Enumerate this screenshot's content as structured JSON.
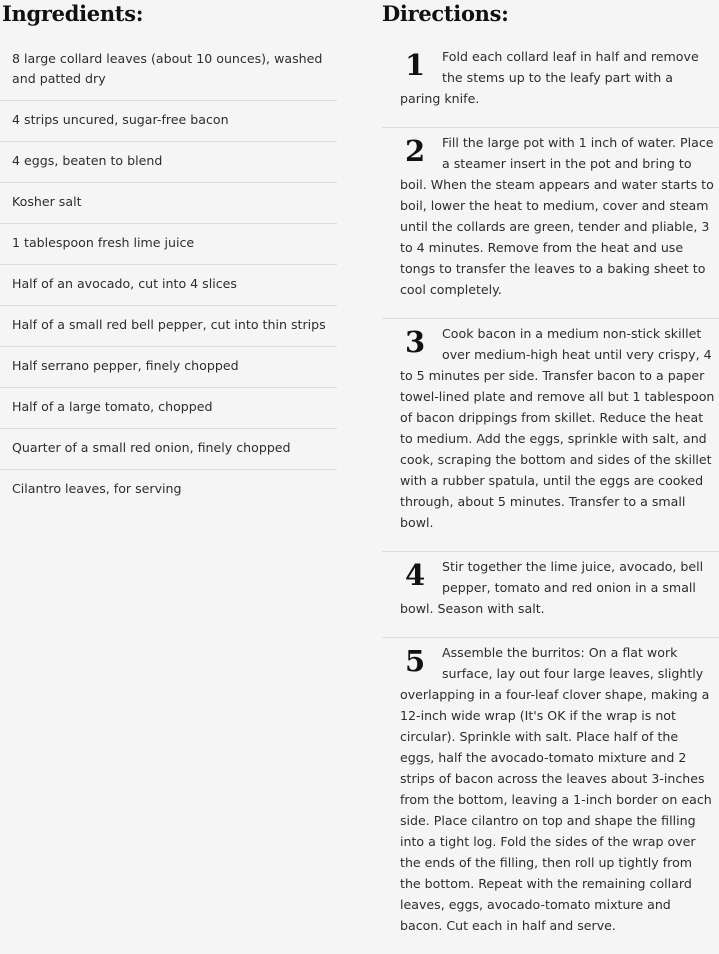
{
  "ingredients": {
    "heading": "Ingredients:",
    "items": [
      "8 large collard leaves (about 10 ounces), washed and patted dry",
      "4 strips uncured, sugar-free bacon",
      "4 eggs, beaten to blend",
      "Kosher salt",
      "1 tablespoon fresh lime juice",
      "Half of an avocado, cut into 4 slices",
      "Half of a small red bell pepper, cut into thin strips",
      "Half serrano pepper, finely chopped",
      "Half of a large tomato, chopped",
      "Quarter of a small red onion, finely chopped",
      "Cilantro leaves, for serving"
    ]
  },
  "directions": {
    "heading": "Directions:",
    "steps": [
      {
        "number": "1",
        "text": "Fold each collard leaf in half and remove the stems up to the leafy part with a paring knife."
      },
      {
        "number": "2",
        "text": "Fill the large pot with 1 inch of water. Place a steamer insert in the pot and bring to boil. When the steam appears and water starts to boil, lower the heat to medium, cover and steam until the collards are green, tender and pliable, 3 to 4 minutes. Remove from the heat and use tongs to transfer the leaves to a baking sheet to cool completely."
      },
      {
        "number": "3",
        "text": "Cook bacon in a medium non-stick skillet over medium-high heat until very crispy, 4 to 5 minutes per side. Transfer bacon to a paper towel-lined plate and remove all but 1 tablespoon of bacon drippings from skillet. Reduce the heat to medium. Add the eggs, sprinkle with salt, and cook, scraping the bottom and sides of the skillet with a rubber spatula, until the eggs are cooked through, about 5 minutes. Transfer to a small bowl."
      },
      {
        "number": "4",
        "text": "Stir together the lime juice, avocado, bell pepper, tomato and red onion in a small bowl. Season with salt."
      },
      {
        "number": "5",
        "text": "Assemble the burritos: On a flat work surface, lay out four large leaves, slightly overlapping in a four-leaf clover shape, making a 12-inch wide wrap (It's OK if the wrap is not circular). Sprinkle with salt. Place half of the eggs, half the avocado-tomato mixture and 2 strips of bacon across the leaves about 3-inches from the bottom, leaving a 1-inch border on each side. Place cilantro on top and shape the filling into a tight log. Fold the sides of the wrap over the ends of the filling, then roll up tightly from the bottom. Repeat with the remaining collard leaves, eggs, avocado-tomato mixture and bacon. Cut each in half and serve."
      }
    ]
  }
}
